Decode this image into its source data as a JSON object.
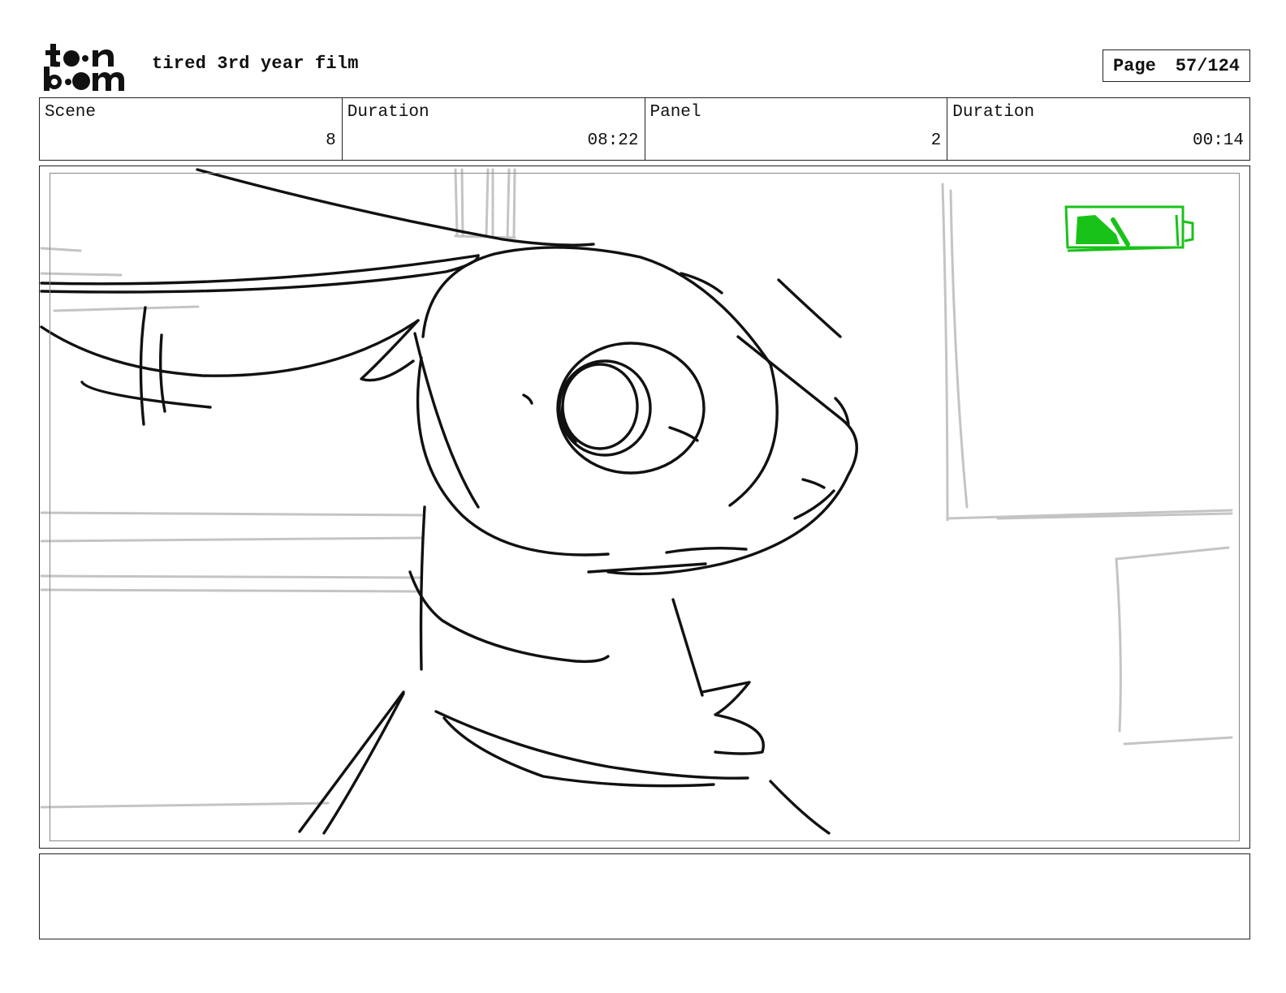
{
  "header": {
    "logo_text": "toon boom",
    "project_title": "tired 3rd year film",
    "page_label": "Page",
    "page_number": "57/124"
  },
  "info": {
    "scene_label": "Scene",
    "scene_value": "8",
    "scene_duration_label": "Duration",
    "scene_duration_value": "08:22",
    "panel_label": "Panel",
    "panel_value": "2",
    "panel_duration_label": "Duration",
    "panel_duration_value": "00:14"
  },
  "panel": {
    "battery_color": "#19c219",
    "sketch_color": "#111111",
    "background_sketch_color": "#c4c4c4"
  },
  "notes": {
    "text": ""
  }
}
